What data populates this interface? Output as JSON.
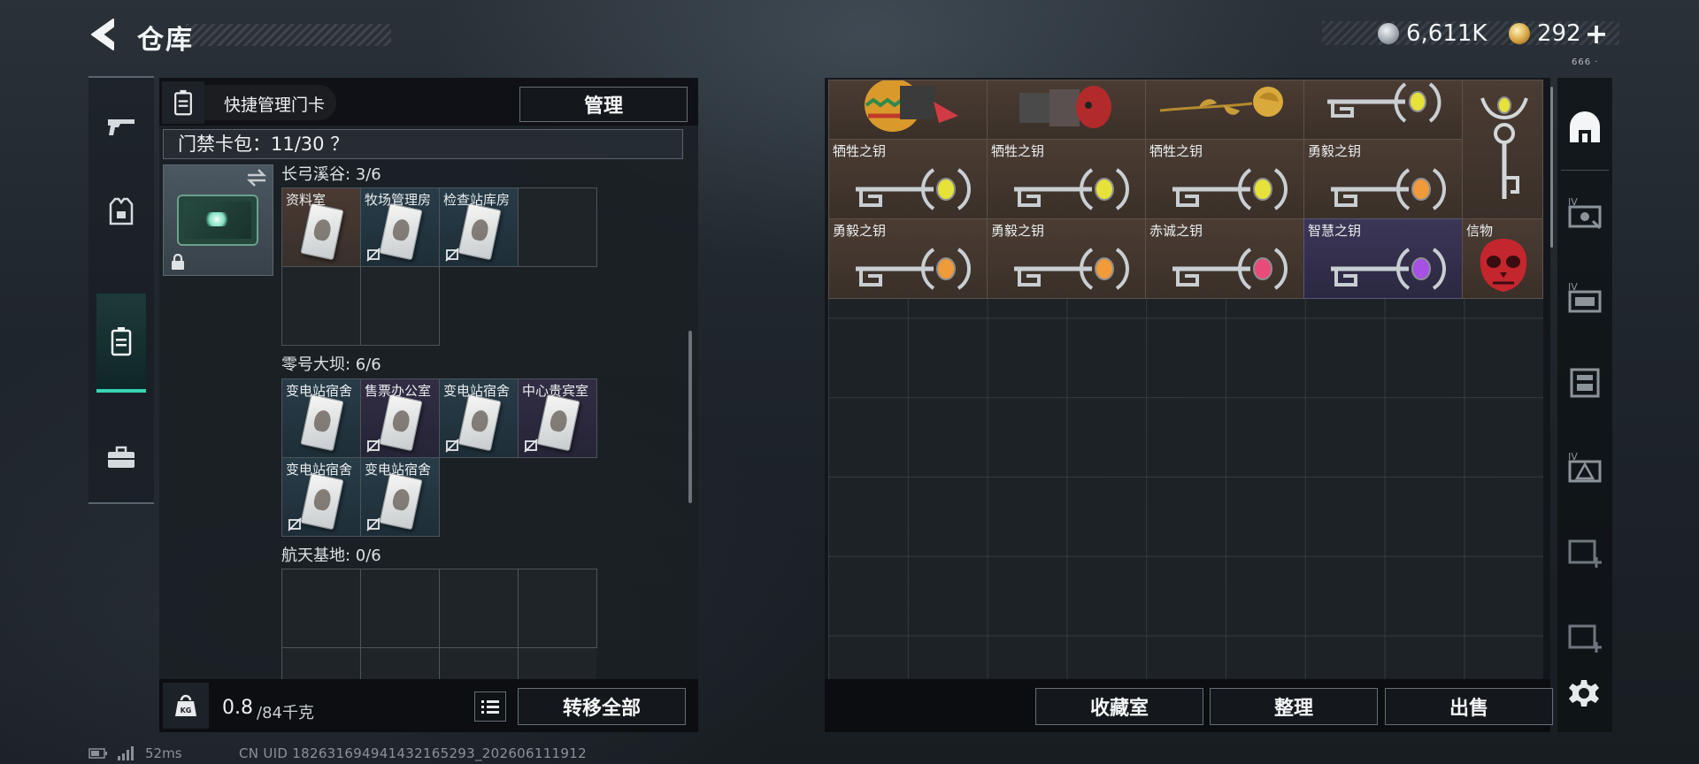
{
  "header": {
    "title": "仓库",
    "currency_silver": "6,611K",
    "currency_gold": "292",
    "currency_plus": "+",
    "top_marks": "666 ·"
  },
  "left_panel": {
    "quick_card_label": "快捷管理门卡",
    "manage_button": "管理",
    "capacity_text": "门禁卡包：11/30  ？",
    "regions": [
      {
        "title": "长弓溪谷: 3/6",
        "cards": [
          "资料室",
          "牧场管理房",
          "检查站库房"
        ]
      },
      {
        "title": "零号大坝: 6/6",
        "cards": [
          "变电站宿舍",
          "售票办公室",
          "变电站宿舍",
          "中心贵宾室",
          "变电站宿舍",
          "变电站宿舍"
        ]
      },
      {
        "title": "航天基地: 0/6",
        "cards": []
      }
    ],
    "weight_value": "0.8",
    "weight_max": "/84千克",
    "transfer_all_button": "转移全部"
  },
  "status": {
    "ping": "52ms",
    "uid": "CN UID 1826316949414321652​93_202606111912"
  },
  "stash": {
    "items": [
      {
        "label": "",
        "kind": "egg"
      },
      {
        "label": "",
        "kind": "figure"
      },
      {
        "label": "",
        "kind": "rose"
      },
      {
        "label": "",
        "kind": "key-yellow"
      },
      {
        "label": "",
        "kind": "tall-key"
      },
      {
        "label": "牺牲之钥",
        "kind": "key-yellow"
      },
      {
        "label": "牺牲之钥",
        "kind": "key-yellow"
      },
      {
        "label": "牺牲之钥",
        "kind": "key-yellow"
      },
      {
        "label": "勇毅之钥",
        "kind": "key-orange"
      },
      {
        "label": "勇毅之钥",
        "kind": "key-orange"
      },
      {
        "label": "勇毅之钥",
        "kind": "key-orange"
      },
      {
        "label": "赤诚之钥",
        "kind": "key-pink"
      },
      {
        "label": "智慧之钥",
        "kind": "key-purple"
      },
      {
        "label": "信物",
        "kind": "mask"
      }
    ],
    "buttons": {
      "collection": "收藏室",
      "sort": "整理",
      "sell": "出售"
    }
  },
  "right_nav_badges": [
    "IV",
    "IV",
    "IV"
  ],
  "colors": {
    "accent_teal": "#37d6b2",
    "key_yellow": "#e6e23a",
    "key_orange": "#f09a3a",
    "key_pink": "#e84b7a",
    "key_purple": "#a650e6"
  }
}
